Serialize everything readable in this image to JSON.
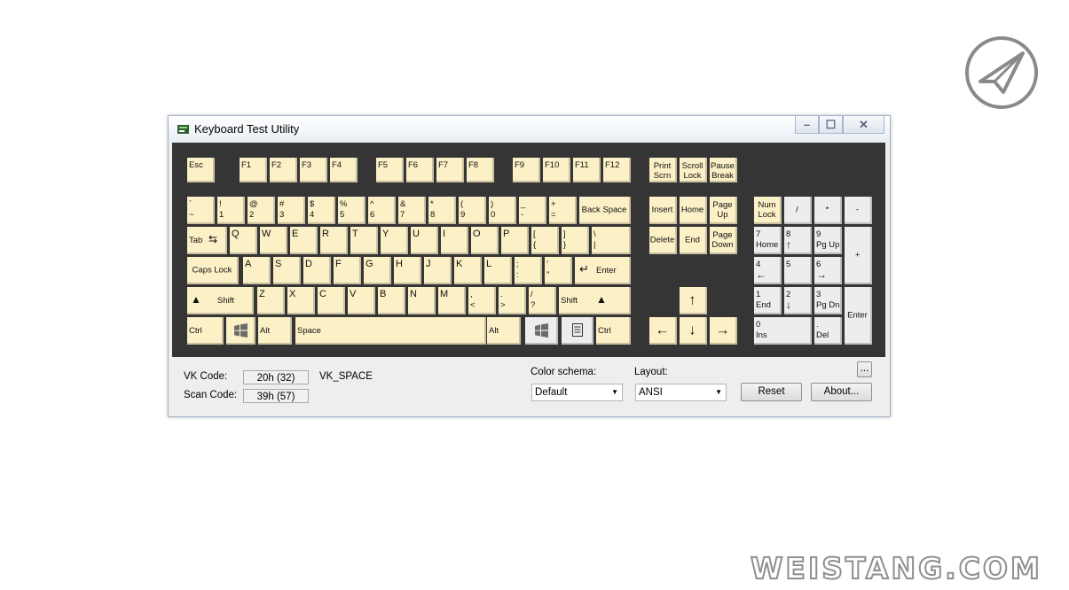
{
  "window": {
    "title": "Keyboard Test Utility"
  },
  "watermark": "WEISTANG.COM",
  "colors": {
    "key": "#fcf0c6",
    "board": "#353535",
    "key_pressed": "#ededed"
  },
  "keys": {
    "esc": "Esc",
    "f1": "F1",
    "f2": "F2",
    "f3": "F3",
    "f4": "F4",
    "f5": "F5",
    "f6": "F6",
    "f7": "F7",
    "f8": "F8",
    "f9": "F9",
    "f10": "F10",
    "f11": "F11",
    "f12": "F12",
    "prtsc": [
      "Print",
      "Scrn"
    ],
    "scroll": [
      "Scroll",
      "Lock"
    ],
    "pause": [
      "Pause",
      "Break"
    ],
    "grave": [
      "`",
      "~"
    ],
    "d1": [
      "!",
      "1"
    ],
    "d2": [
      "@",
      "2"
    ],
    "d3": [
      "#",
      "3"
    ],
    "d4": [
      "$",
      "4"
    ],
    "d5": [
      "%",
      "5"
    ],
    "d6": [
      "^",
      "6"
    ],
    "d7": [
      "&",
      "7"
    ],
    "d8": [
      "*",
      "8"
    ],
    "d9": [
      "(",
      "9"
    ],
    "d0": [
      ")",
      "0"
    ],
    "minus": [
      "_",
      "-"
    ],
    "equal": [
      "+",
      "="
    ],
    "backspace": "Back Space",
    "tab": "Tab",
    "q": "Q",
    "w": "W",
    "e": "E",
    "r": "R",
    "t": "T",
    "y": "Y",
    "u": "U",
    "i": "I",
    "o": "O",
    "p": "P",
    "lbracket": [
      "[",
      "{"
    ],
    "rbracket": [
      "]",
      "}"
    ],
    "backslash": [
      "\\",
      "|"
    ],
    "caps": "Caps Lock",
    "a": "A",
    "s": "S",
    "d": "D",
    "f": "F",
    "g": "G",
    "h": "H",
    "j": "J",
    "k": "K",
    "l": "L",
    "semicolon": [
      ";",
      ":"
    ],
    "quote": [
      "'",
      "\""
    ],
    "enter": "Enter",
    "lshift": "Shift",
    "z": "Z",
    "x": "X",
    "c": "C",
    "v": "V",
    "b": "B",
    "n": "N",
    "m": "M",
    "comma": [
      ",",
      "<"
    ],
    "period": [
      ".",
      ">"
    ],
    "slash": [
      "/",
      "?"
    ],
    "rshift": "Shift",
    "lctrl": "Ctrl",
    "lalt": "Alt",
    "space": "Space",
    "ralt": "Alt",
    "rctrl": "Ctrl",
    "insert": "Insert",
    "home": "Home",
    "pgup": [
      "Page",
      "Up"
    ],
    "delete": "Delete",
    "end": "End",
    "pgdn": [
      "Page",
      "Down"
    ],
    "numlock": [
      "Num",
      "Lock"
    ],
    "numdiv": "/",
    "nummul": "*",
    "numsub": "-",
    "numadd": "+",
    "num7": [
      "7",
      "Home"
    ],
    "num8": [
      "8",
      "↑"
    ],
    "num9": [
      "9",
      "Pg Up"
    ],
    "num4": [
      "4",
      "←"
    ],
    "num5": "5",
    "num6": [
      "6",
      "→"
    ],
    "num1": [
      "1",
      "End"
    ],
    "num2": [
      "2",
      "↓"
    ],
    "num3": [
      "3",
      "Pg Dn"
    ],
    "num0": [
      "0",
      "Ins"
    ],
    "numdec": [
      ".",
      "Del"
    ],
    "numenter": "Enter"
  },
  "info": {
    "vk_label": "VK Code:",
    "vk_value": "20h (32)",
    "vk_name": "VK_SPACE",
    "scan_label": "Scan Code:",
    "scan_value": "39h (57)"
  },
  "options": {
    "color_label": "Color schema:",
    "color_value": "Default",
    "layout_label": "Layout:",
    "layout_value": "ANSI",
    "more_label": "...",
    "reset_label": "Reset",
    "about_label": "About..."
  }
}
